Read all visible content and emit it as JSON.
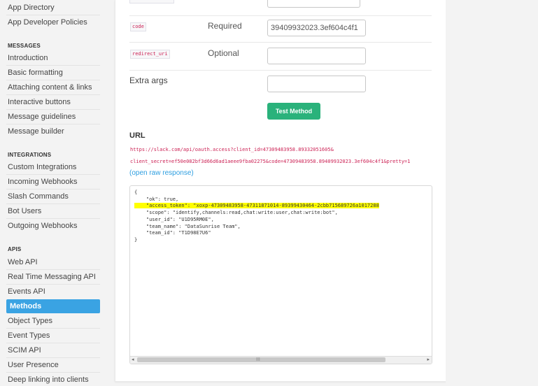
{
  "sidebar": {
    "top_items": [
      "App Directory",
      "App Developer Policies"
    ],
    "messages_heading": "MESSAGES",
    "messages_items": [
      "Introduction",
      "Basic formatting",
      "Attaching content & links",
      "Interactive buttons",
      "Message guidelines",
      "Message builder"
    ],
    "integrations_heading": "INTEGRATIONS",
    "integrations_items": [
      "Custom Integrations",
      "Incoming Webhooks",
      "Slash Commands",
      "Bot Users",
      "Outgoing Webhooks"
    ],
    "apis_heading": "APIS",
    "apis_items": [
      "Web API",
      "Real Time Messaging API",
      "Events API",
      "Methods",
      "Object Types",
      "Event Types",
      "SCIM API",
      "User Presence",
      "Deep linking into clients"
    ],
    "active_item": "Methods"
  },
  "form": {
    "rows": [
      {
        "arg": "code",
        "requirement": "Required",
        "value": "39409932023.3ef604c4f1"
      },
      {
        "arg": "redirect_uri",
        "requirement": "Optional",
        "value": ""
      }
    ],
    "extra_args_label": "Extra args",
    "extra_args_value": "",
    "test_button": "Test Method"
  },
  "url_section": {
    "heading": "URL",
    "line1": "https://slack.com/api/oauth.access?client_id=47309483958.89332051605&",
    "line2": "client_secret=ef50e082bf3d66d6ad1aeee9fba02275&code=47309483958.89409932023.3ef604c4f1&pretty=1",
    "raw_link": "(open raw response)"
  },
  "response": {
    "open_brace": "{",
    "ok_line": "    \"ok\": true,",
    "token_line": "    \"access_token\": \"xoxp-47309483958-47311871014-89399430464-2cbb715689726a1017288",
    "scope_line": "    \"scope\": \"identify,channels:read,chat:write:user,chat:write:bot\",",
    "user_line": "    \"user_id\": \"U1D95RM0E\",",
    "team_name_line": "    \"team_name\": \"DataSunrise Team\",",
    "team_id_line": "    \"team_id\": \"T1D98E7U6\"",
    "close_brace": "}",
    "highlight_color": "#ffff00"
  },
  "scrollbar": {
    "left_arrow": "◂",
    "right_arrow": "▸",
    "grip": "III"
  },
  "colors": {
    "accent": "#3aa3e3",
    "button": "#2ab27b",
    "code": "#cc2255",
    "link": "#2d9ee0"
  }
}
